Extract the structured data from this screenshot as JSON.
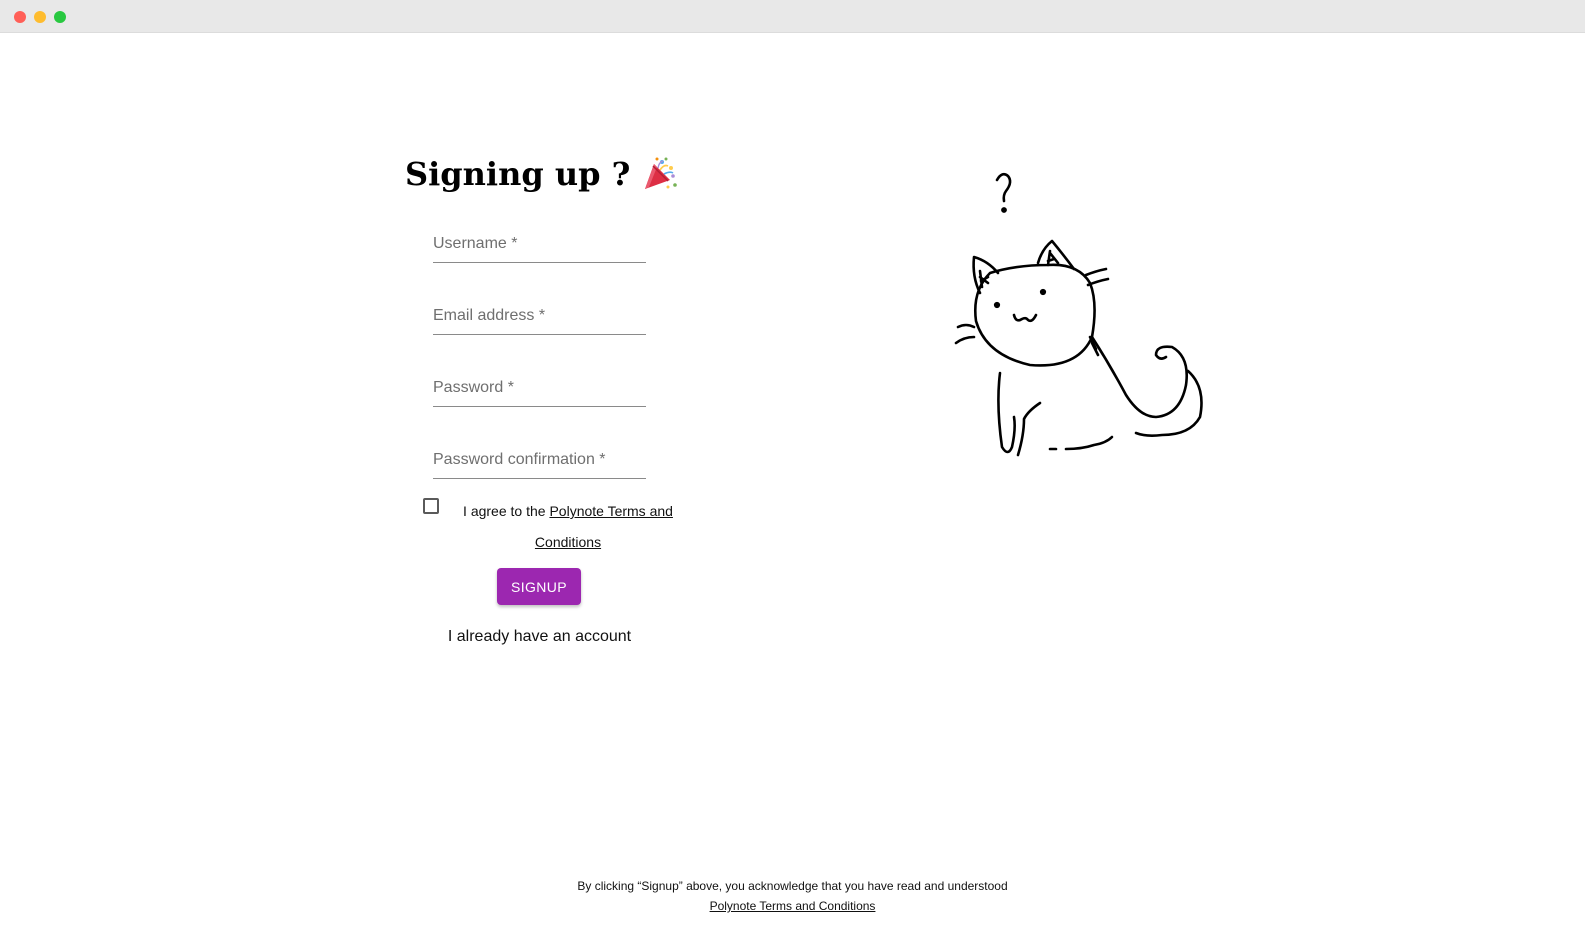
{
  "page": {
    "title": "Signing up ?",
    "title_icon": "party-popper-icon"
  },
  "form": {
    "username_label": "Username *",
    "email_label": "Email address *",
    "password_label": "Password *",
    "password_confirmation_label": "Password confirmation *",
    "agree_prefix": "I agree to the ",
    "agree_link": "Polynote Terms and Conditions",
    "signup_label": "SIGNUP",
    "have_account_label": "I already have an account"
  },
  "footer": {
    "notice": "By clicking “Signup” above, you acknowledge that you have read and understood",
    "terms_link": "Polynote Terms and Conditions"
  },
  "colors": {
    "accent": "#9c27b0",
    "titlebar": "#e8e8e8"
  },
  "illustration": {
    "icon": "confused-cat-icon"
  }
}
